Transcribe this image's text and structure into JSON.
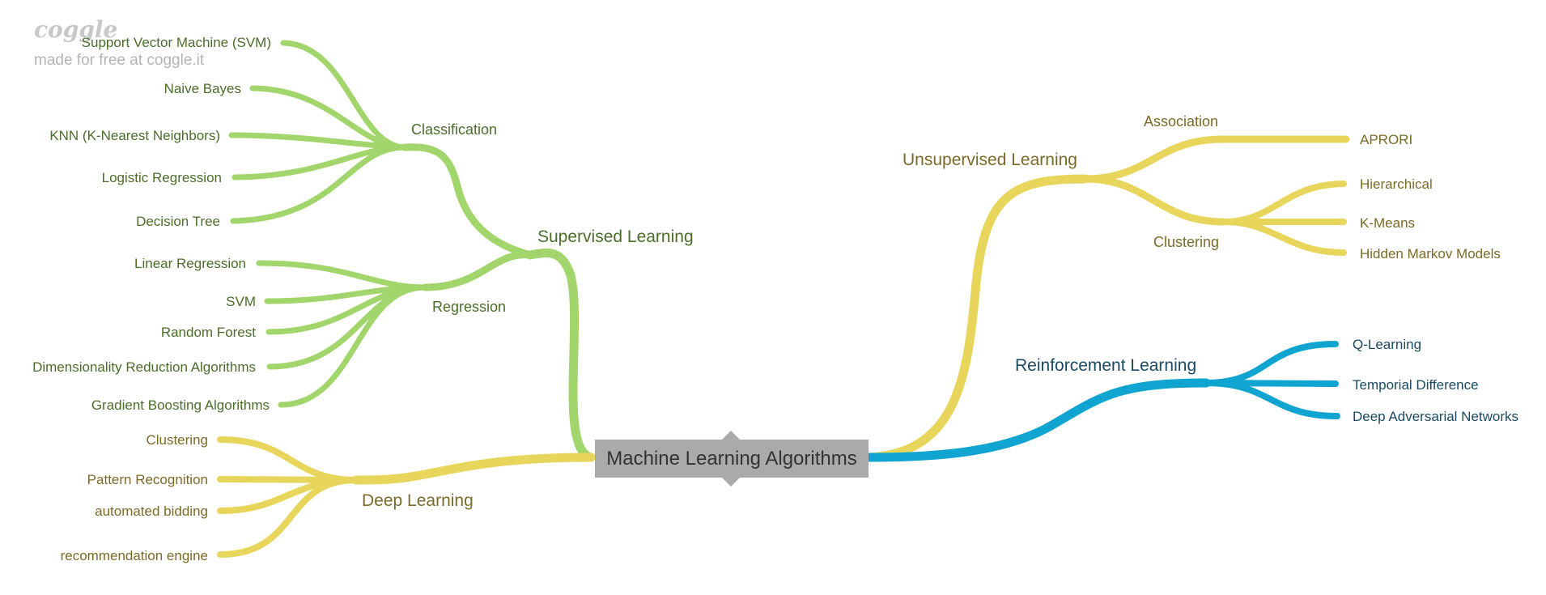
{
  "watermark": {
    "logo": "coggle",
    "credit": "made for free at coggle.it"
  },
  "colors": {
    "green": "#a2d66c",
    "yellow": "#e8d65c",
    "blue": "#0fa5d0",
    "root": "#aaaaaa"
  },
  "root": {
    "label": "Machine Learning Algorithms"
  },
  "supervised": {
    "label": "Supervised Learning",
    "classification": {
      "label": "Classification",
      "items": [
        "Support Vector Machine (SVM)",
        "Naive Bayes",
        "KNN (K-Nearest Neighbors)",
        "Logistic Regression",
        "Decision Tree"
      ]
    },
    "regression": {
      "label": "Regression",
      "items": [
        "Linear Regression",
        "SVM",
        "Random Forest",
        "Dimensionality Reduction Algorithms",
        "Gradient Boosting Algorithms"
      ]
    }
  },
  "deep": {
    "label": "Deep Learning",
    "items": [
      "Clustering",
      "Pattern Recognition",
      "automated bidding",
      "recommendation engine"
    ]
  },
  "unsupervised": {
    "label": "Unsupervised Learning",
    "association": {
      "label": "Association",
      "items": [
        "APRORI"
      ]
    },
    "clustering": {
      "label": "Clustering",
      "items": [
        "Hierarchical",
        "K-Means",
        "Hidden Markov Models"
      ]
    }
  },
  "reinforcement": {
    "label": "Reinforcement Learning",
    "items": [
      "Q-Learning",
      "Temporial Difference",
      "Deep Adversarial Networks"
    ]
  }
}
